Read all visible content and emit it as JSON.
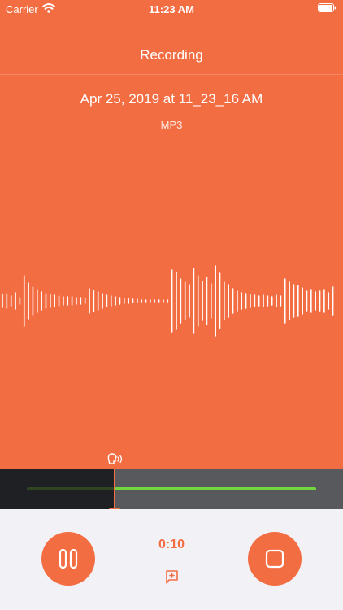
{
  "status_bar": {
    "carrier": "Carrier",
    "time": "11:23 AM",
    "icons": [
      "wifi-icon",
      "battery-icon"
    ]
  },
  "nav": {
    "title": "Recording"
  },
  "recording": {
    "name": "Apr 25, 2019 at 11_23_16 AM",
    "format": "MP3"
  },
  "playback": {
    "elapsed": "0:10",
    "progress_fraction": 0.3,
    "pause_icon": "pause-icon",
    "stop_icon": "stop-icon",
    "marker_icon": "add-marker-icon",
    "speech_icon": "voice-activity-icon"
  },
  "colors": {
    "accent": "#f36d43",
    "timeline_past": "#1e2023",
    "timeline_future": "#57595c",
    "track_active": "#74d63e",
    "controls_bg": "#f2f2f6"
  }
}
